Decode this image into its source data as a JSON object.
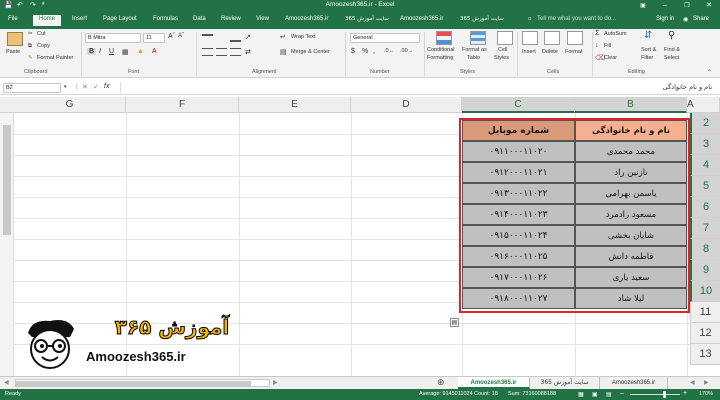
{
  "window": {
    "title": "Amoozesh365.ir - Excel",
    "sign_in": "Sign in",
    "share": "Share",
    "tell_me": "Tell me what you want to do..."
  },
  "tabs": [
    "File",
    "Home",
    "Insert",
    "Page Layout",
    "Formulas",
    "Data",
    "Review",
    "View",
    "Amoozesh365.ir",
    "سایت آموزش 365",
    "Amoozesh365.ir",
    "سایت آموزش 365"
  ],
  "ribbon": {
    "clipboard": {
      "paste": "Paste",
      "cut": "Cut",
      "copy": "Copy",
      "format_painter": "Format Painter",
      "label": "Clipboard"
    },
    "font": {
      "name": "B Mitra",
      "size": "11",
      "label": "Font"
    },
    "alignment": {
      "wrap": "Wrap Text",
      "merge": "Merge & Center",
      "label": "Alignment"
    },
    "number": {
      "format": "General",
      "label": "Number"
    },
    "styles": {
      "conditional": "Conditional",
      "formatting": "Formatting",
      "format_as": "Format as",
      "table": "Table",
      "cell": "Cell",
      "styles": "Styles",
      "label": "Styles"
    },
    "cells": {
      "insert": "Insert",
      "delete": "Delete",
      "format": "Format",
      "label": "Cells"
    },
    "editing": {
      "autosum": "AutoSum",
      "fill": "Fill",
      "clear": "Clear",
      "sort": "Sort &",
      "filter": "Filter",
      "find": "Find &",
      "select": "Select",
      "label": "Editing"
    }
  },
  "formula_bar": {
    "name_box": "B2",
    "fx": "fx",
    "content": "نام و نام خانوادگی"
  },
  "columns": [
    "G",
    "F",
    "E",
    "D",
    "C",
    "B",
    "A"
  ],
  "rows": [
    "2",
    "3",
    "4",
    "5",
    "6",
    "7",
    "8",
    "9",
    "10",
    "11",
    "12",
    "13"
  ],
  "table": {
    "header_name": "نام و نام خانوادگی",
    "header_phone": "شماره موبایل",
    "names": [
      "محمد محمدی",
      "نازنین راد",
      "یاسمن بهرامی",
      "مسعود رادمرد",
      "شایان بخشی",
      "فاطمه دانش",
      "سعید یاری",
      "لیلا شاد"
    ],
    "phones": [
      "۰۹۱۱۰۰۰۱۱۰۲۰",
      "۰۹۱۲۰۰۰۱۱۰۲۱",
      "۰۹۱۳۰۰۰۱۱۰۲۲",
      "۰۹۱۴۰۰۰۱۱۰۲۳",
      "۰۹۱۵۰۰۰۱۱۰۲۴",
      "۰۹۱۶۰۰۰۱۱۰۲۵",
      "۰۹۱۷۰۰۰۱۱۰۲۶",
      "۰۹۱۸۰۰۰۱۱۰۲۷"
    ]
  },
  "logo": {
    "persian": "آموزش ۳۶۵",
    "latin": "Amoozesh365.ir"
  },
  "sheet_tabs": [
    "Amoozesh365.ir",
    "سایت آموزش 365",
    "Amoozesh365.ir"
  ],
  "status": {
    "ready": "Ready",
    "average": "Average: 9145011024",
    "count": "Count: 18",
    "sum": "Sum: 73160088188",
    "zoom": "170%"
  },
  "colors": {
    "excel_green": "#217346",
    "header_fill": "#f7b08f",
    "data_fill": "#c0c0c0",
    "selection_red": "#d9262e"
  }
}
